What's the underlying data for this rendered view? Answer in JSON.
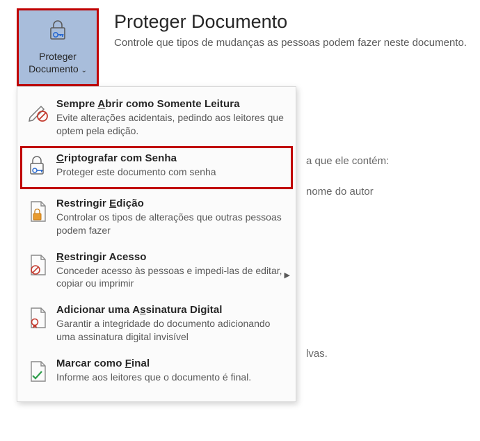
{
  "header": {
    "button_line1": "Proteger",
    "button_line2": "Documento",
    "title": "Proteger Documento",
    "subtitle": "Controle que tipos de mudanças as pessoas podem fazer neste documento."
  },
  "menu": {
    "readonly": {
      "title_pre": "Sempre ",
      "title_ul": "A",
      "title_post": "brir como Somente Leitura",
      "desc": "Evite alterações acidentais, pedindo aos leitores que optem pela edição."
    },
    "encrypt": {
      "title_pre": "",
      "title_ul": "C",
      "title_post": "riptografar com Senha",
      "desc": "Proteger este documento com senha"
    },
    "restrict_edit": {
      "title_pre": "Restringir ",
      "title_ul": "E",
      "title_post": "dição",
      "desc": "Controlar os tipos de alterações que outras pessoas podem fazer"
    },
    "restrict_access": {
      "title_ul": "R",
      "title_post": "estringir Acesso",
      "desc": "Conceder acesso às pessoas e impedi-las de editar, copiar ou imprimir"
    },
    "signature": {
      "title_pre": "Adicionar uma A",
      "title_ul": "s",
      "title_post": "sinatura Digital",
      "desc": "Garantir a integridade do documento adicionando uma assinatura digital invisível"
    },
    "final": {
      "title_pre": "Marcar como ",
      "title_ul": "F",
      "title_post": "inal",
      "desc": "Informe aos leitores que o documento é final."
    }
  },
  "bg": {
    "l1": "a que ele contém:",
    "l2": "nome do autor",
    "l3": "lvas."
  }
}
